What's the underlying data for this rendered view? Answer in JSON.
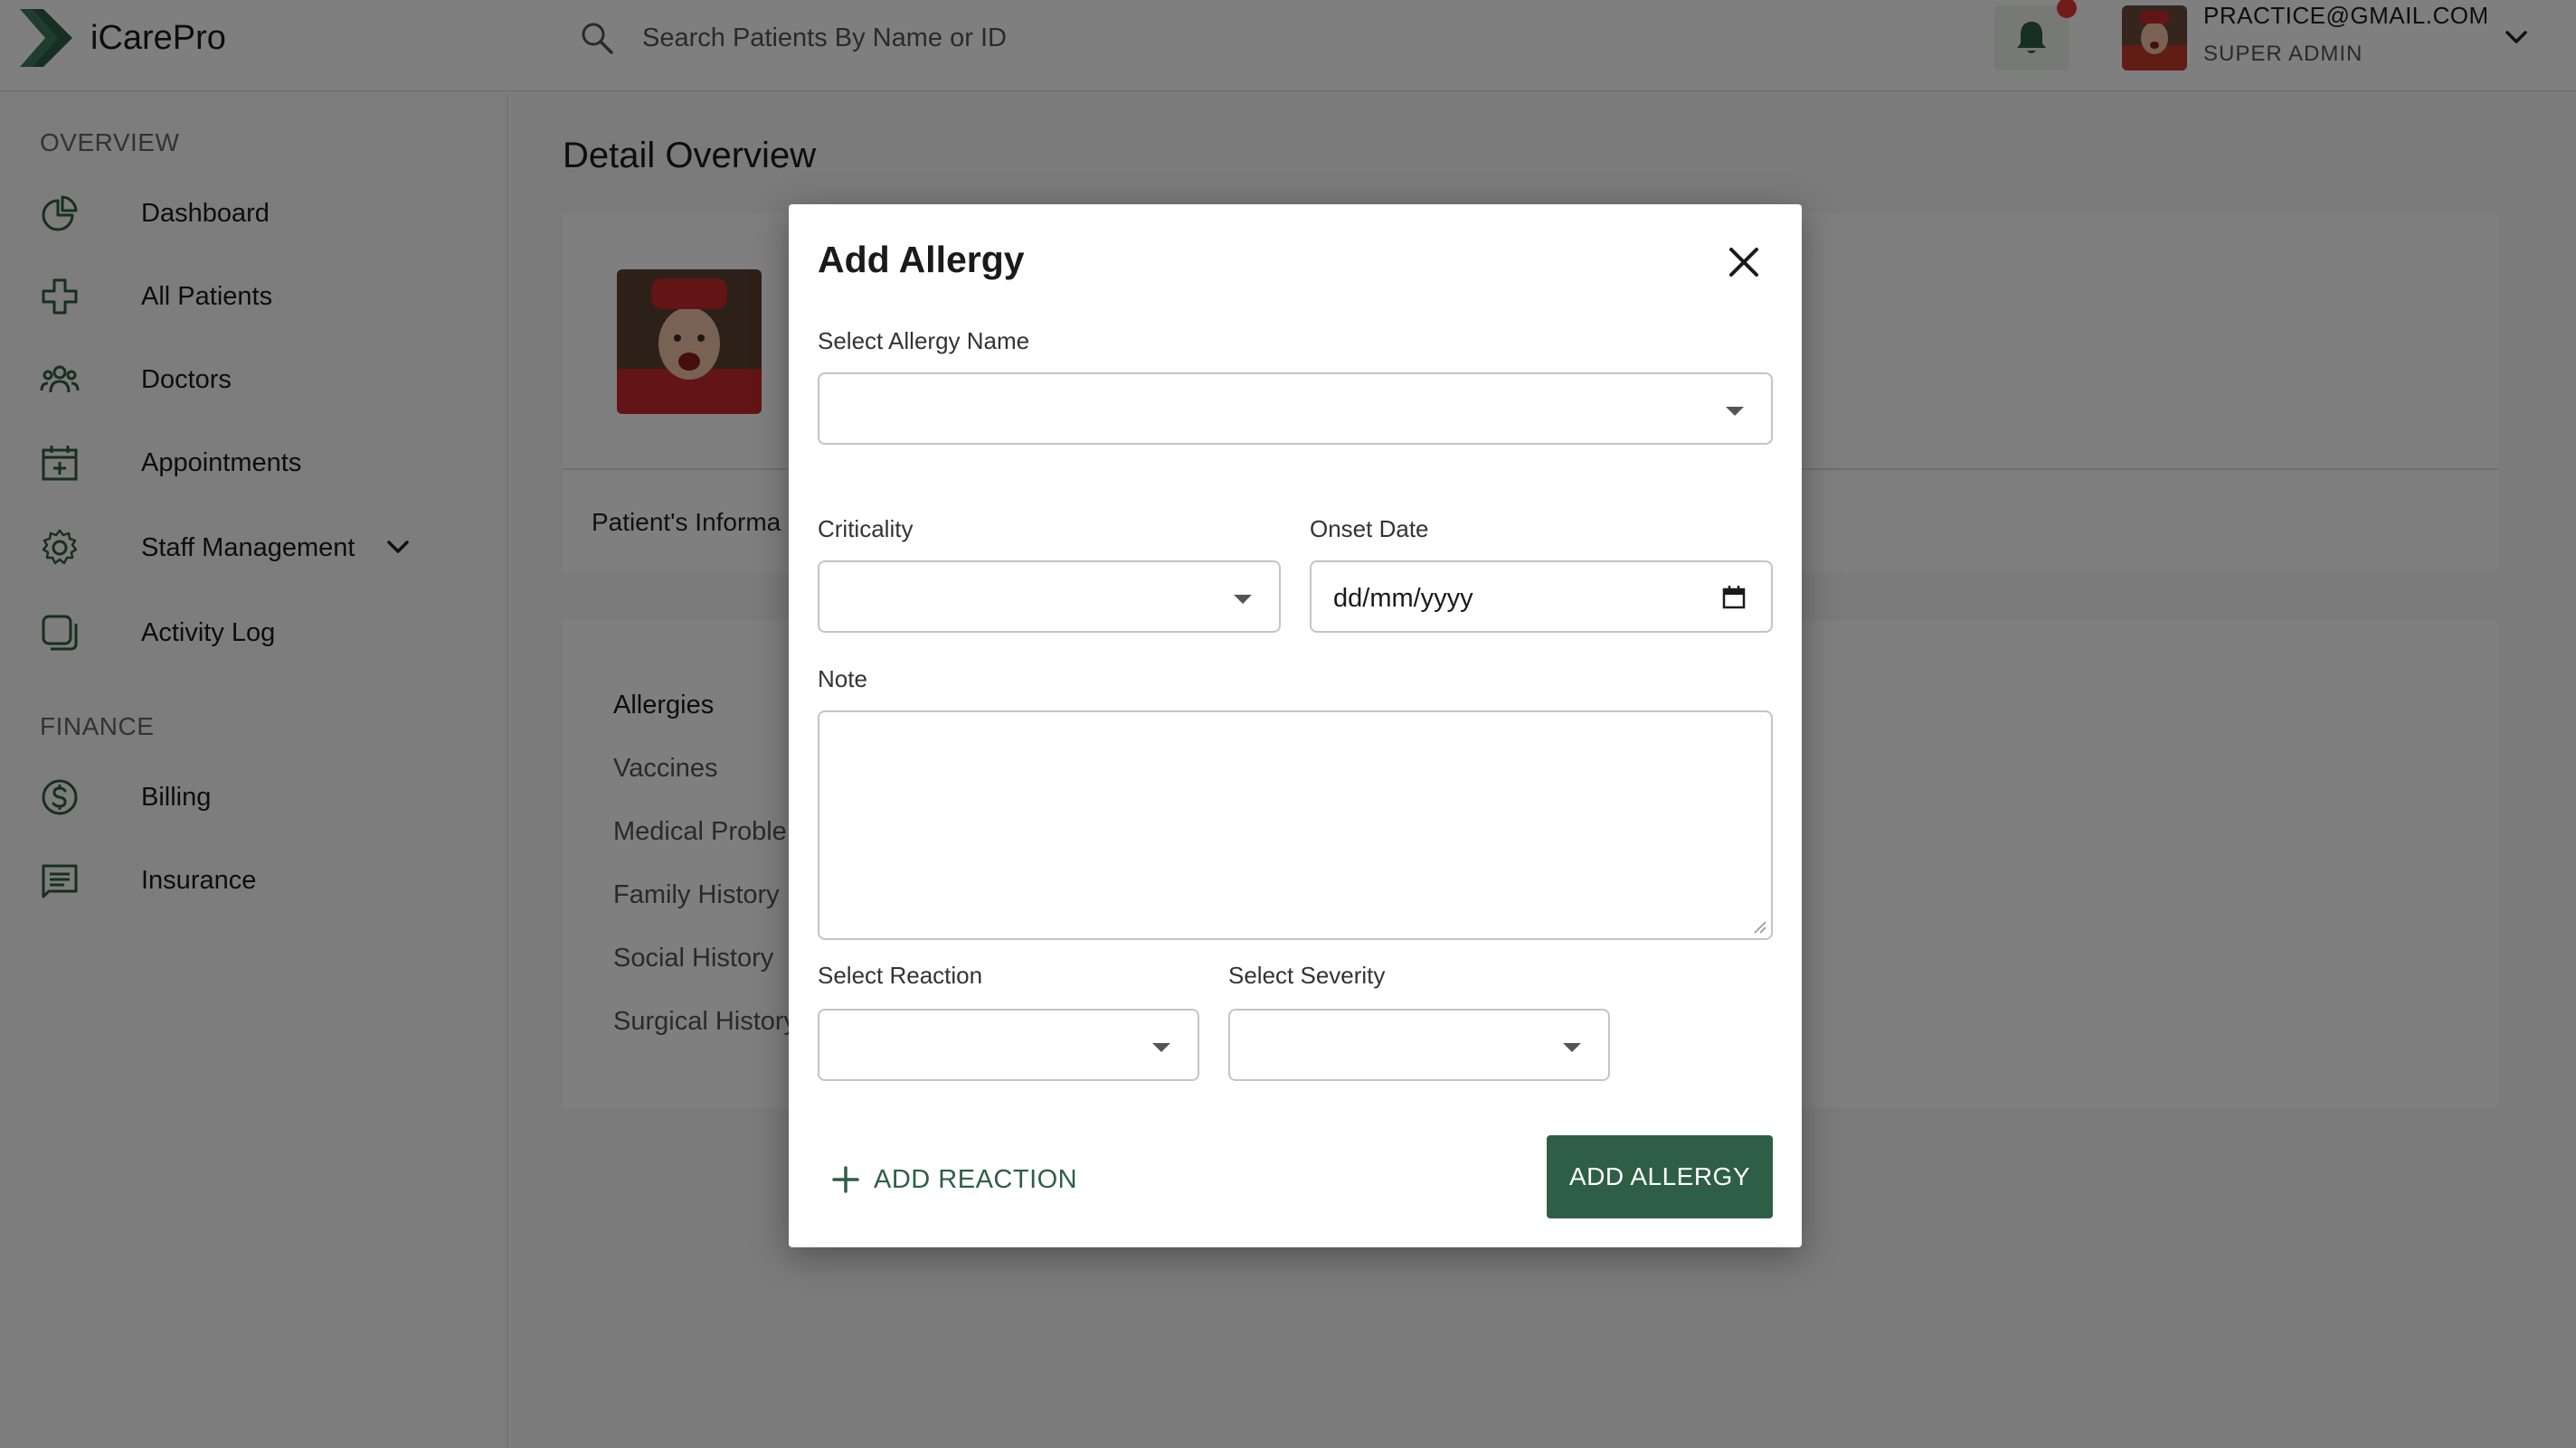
{
  "app": {
    "name": "iCarePro",
    "brand_color": "#2e5e45"
  },
  "search": {
    "placeholder": "Search Patients By Name or ID"
  },
  "user": {
    "email": "PRACTICE@GMAIL.COM",
    "role": "SUPER ADMIN",
    "notification_dot_color": "#e53935"
  },
  "sidebar": {
    "sections": [
      {
        "title": "OVERVIEW"
      },
      {
        "title": "FINANCE"
      }
    ],
    "items": [
      {
        "label": "Dashboard",
        "icon": "pie-chart-icon"
      },
      {
        "label": "All Patients",
        "icon": "medical-cross-icon"
      },
      {
        "label": "Doctors",
        "icon": "users-icon"
      },
      {
        "label": "Appointments",
        "icon": "calendar-plus-icon"
      },
      {
        "label": "Staff Management",
        "icon": "gear-icon"
      },
      {
        "label": "Activity Log",
        "icon": "copy-icon"
      },
      {
        "label": "Billing",
        "icon": "dollar-circle-icon"
      },
      {
        "label": "Insurance",
        "icon": "message-square-icon"
      }
    ]
  },
  "main": {
    "title": "Detail Overview",
    "info_tab": "Patient's Informa",
    "history_menu": [
      "Allergies",
      "Vaccines",
      "Medical Proble",
      "Family History",
      "Social History",
      "Surgical History"
    ]
  },
  "modal": {
    "title": "Add Allergy",
    "allergy_name_label": "Select Allergy Name",
    "criticality_label": "Criticality",
    "onset_date_label": "Onset Date",
    "onset_date_placeholder": "dd/mm/yyyy",
    "note_label": "Note",
    "reaction_label": "Select Reaction",
    "severity_label": "Select Severity",
    "add_reaction": "ADD REACTION",
    "submit": "ADD ALLERGY"
  }
}
